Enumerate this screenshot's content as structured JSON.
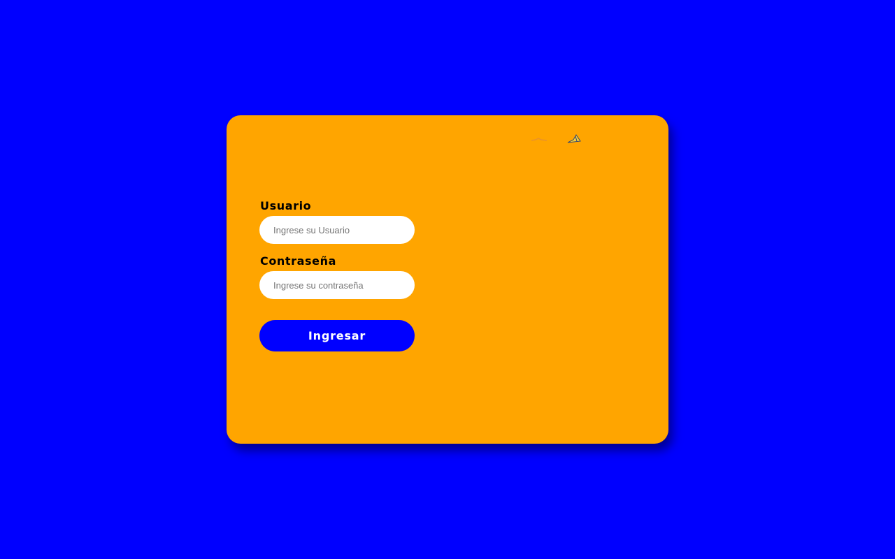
{
  "colors": {
    "page_background": "#0000ff",
    "card_background": "#ffa500",
    "button_background": "#0000ff",
    "button_text": "#ffffff"
  },
  "logo": {
    "icon": "broken-image-icon"
  },
  "form": {
    "username_label": "Usuario",
    "username_placeholder": "Ingrese su Usuario",
    "username_value": "",
    "password_label": "Contraseña",
    "password_placeholder": "Ingrese su contraseña",
    "password_value": "",
    "submit_label": "Ingresar"
  }
}
